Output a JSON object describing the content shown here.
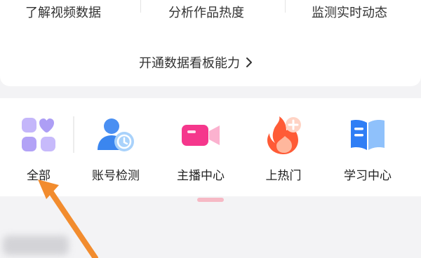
{
  "features": [
    "了解视频数据",
    "分析作品热度",
    "监测实时动态"
  ],
  "open_panel": {
    "label": "开通数据看板能力",
    "icon": "chevron-right-icon"
  },
  "nav": [
    {
      "label": "全部",
      "icon": "grid-all-icon"
    },
    {
      "label": "账号检测",
      "icon": "person-check-icon"
    },
    {
      "label": "主播中心",
      "icon": "video-camera-icon"
    },
    {
      "label": "上热门",
      "icon": "flame-plus-icon"
    },
    {
      "label": "学习中心",
      "icon": "open-book-icon"
    }
  ],
  "colors": {
    "all_icon": "#b9a8f7",
    "account_icon": "#3d8cf0",
    "anchor_icon": "#f5378c",
    "hot_icon": "#ff5a36",
    "study_icon": "#2f7ef5",
    "annotation_arrow": "#f28c2e",
    "active_indicator": "#f6b9c5"
  }
}
